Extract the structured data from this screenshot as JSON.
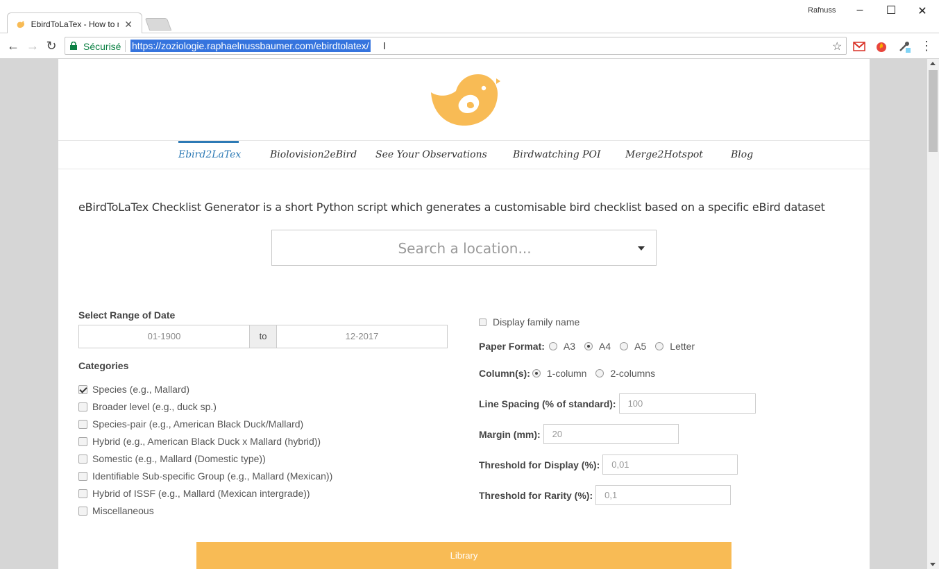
{
  "browser": {
    "tab_title": "EbirdToLaTex - How to m",
    "profile_name": "Rafnuss",
    "secure_label": "Sécurisé",
    "url": "https://zoziologie.raphaelnussbaumer.com/ebirdtolatex/"
  },
  "nav": {
    "items": [
      "Ebird2LaTex",
      "Biolovision2eBird",
      "See Your Observations",
      "Birdwatching POI",
      "Merge2Hotspot",
      "Blog"
    ],
    "active_index": 0
  },
  "intro": "eBirdToLaTex Checklist Generator is a short Python script which generates a customisable bird checklist based on a specific eBird dataset",
  "search": {
    "placeholder": "Search a location..."
  },
  "date_range": {
    "label": "Select Range of Date",
    "from": "01-1900",
    "to_label": "to",
    "to": "12-2017"
  },
  "categories": {
    "label": "Categories",
    "items": [
      {
        "label": "Species (e.g., Mallard)",
        "checked": true
      },
      {
        "label": "Broader level (e.g., duck sp.)",
        "checked": false
      },
      {
        "label": "Species-pair (e.g., American Black Duck/Mallard)",
        "checked": false
      },
      {
        "label": "Hybrid (e.g., American Black Duck x Mallard (hybrid))",
        "checked": false
      },
      {
        "label": "Somestic (e.g., Mallard (Domestic type))",
        "checked": false
      },
      {
        "label": "Identifiable Sub-specific Group (e.g., Mallard (Mexican))",
        "checked": false
      },
      {
        "label": "Hybrid of ISSF (e.g., Mallard (Mexican intergrade))",
        "checked": false
      },
      {
        "label": "Miscellaneous",
        "checked": false
      }
    ]
  },
  "options": {
    "display_family_name": "Display family name",
    "paper_format": {
      "label": "Paper Format:",
      "options": [
        "A3",
        "A4",
        "A5",
        "Letter"
      ],
      "selected": "A4"
    },
    "columns": {
      "label": "Column(s):",
      "options": [
        "1-column",
        "2-columns"
      ],
      "selected": "1-column"
    },
    "line_spacing": {
      "label": "Line Spacing (% of standard):",
      "value": "100"
    },
    "margin": {
      "label": "Margin (mm):",
      "value": "20"
    },
    "threshold_display": {
      "label": "Threshold for Display (%):",
      "value": "0,01"
    },
    "threshold_rarity": {
      "label": "Threshold for Rarity (%):",
      "value": "0,1"
    }
  },
  "library_button": "Library",
  "colors": {
    "accent": "#f8bb55",
    "nav_active": "#2d7ab5",
    "secure": "#0b8043"
  }
}
